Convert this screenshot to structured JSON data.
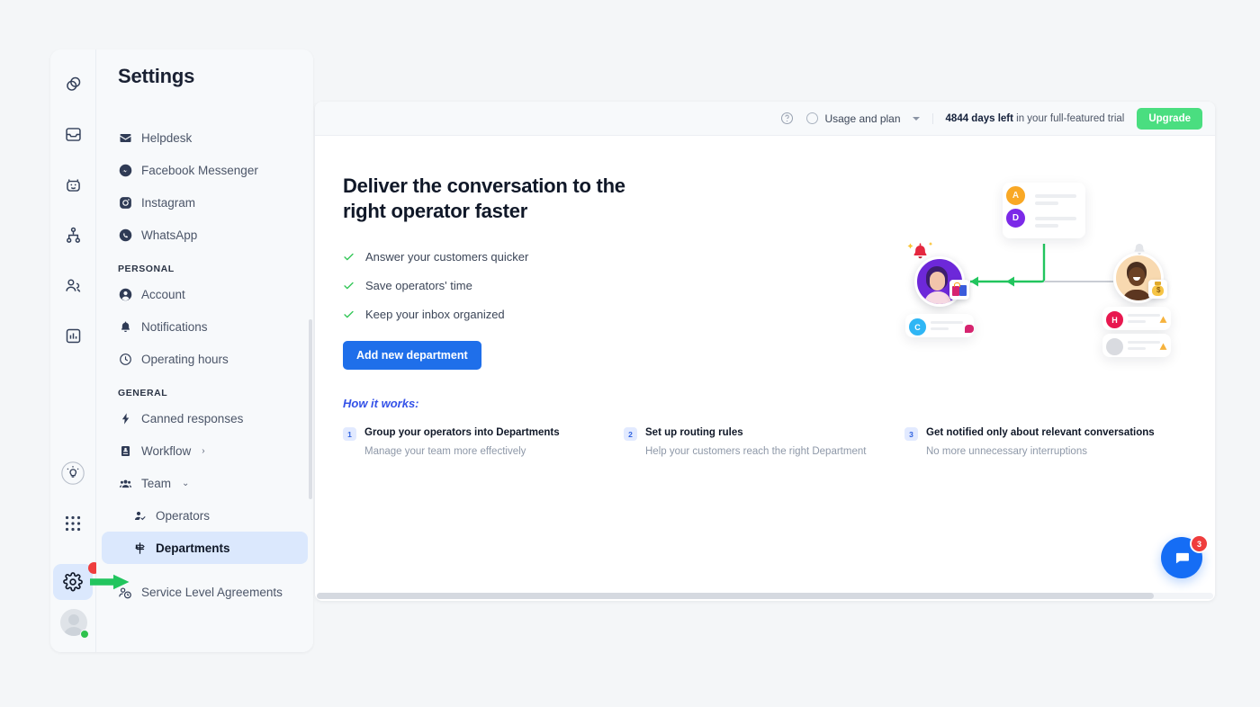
{
  "colors": {
    "accent_blue": "#1f6fea",
    "upgrade_green": "#4ade80",
    "selected_nav": "#dbe8fd",
    "arrow_green": "#22c55e",
    "badge_red": "#ef3d3d",
    "page_bg": "#f4f6f8"
  },
  "rail": {
    "items": [
      {
        "name": "logo-icon",
        "label": "Logo"
      },
      {
        "name": "inbox-icon",
        "label": "Inbox"
      },
      {
        "name": "chatbot-icon",
        "label": "Chatbot"
      },
      {
        "name": "flows-icon",
        "label": "Flows"
      },
      {
        "name": "contacts-icon",
        "label": "Contacts"
      },
      {
        "name": "reports-icon",
        "label": "Reports"
      }
    ],
    "bottom_items": [
      {
        "name": "tips-icon",
        "label": "Tips"
      },
      {
        "name": "apps-grid-icon",
        "label": "Apps"
      },
      {
        "name": "settings-gear-icon",
        "label": "Settings"
      }
    ]
  },
  "sidebar": {
    "title": "Settings",
    "channels": [
      {
        "label": "Helpdesk",
        "icon": "envelope-icon"
      },
      {
        "label": "Facebook Messenger",
        "icon": "messenger-icon"
      },
      {
        "label": "Instagram",
        "icon": "instagram-icon"
      },
      {
        "label": "WhatsApp",
        "icon": "whatsapp-icon"
      }
    ],
    "personal_header": "PERSONAL",
    "personal": [
      {
        "label": "Account",
        "icon": "user-circle-icon"
      },
      {
        "label": "Notifications",
        "icon": "bell-icon"
      },
      {
        "label": "Operating hours",
        "icon": "clock-icon"
      }
    ],
    "general_header": "GENERAL",
    "general": [
      {
        "label": "Canned responses",
        "icon": "bolt-icon",
        "chevron": ""
      },
      {
        "label": "Workflow",
        "icon": "workflow-icon",
        "chevron": "›"
      },
      {
        "label": "Team",
        "icon": "team-icon",
        "chevron": "⌄"
      }
    ],
    "team_children": [
      {
        "label": "Operators",
        "icon": "operator-icon",
        "selected": false
      },
      {
        "label": "Departments",
        "icon": "signpost-icon",
        "selected": true
      }
    ],
    "after_team": [
      {
        "label": "Service Level Agreements",
        "icon": "sla-icon"
      }
    ]
  },
  "topbar": {
    "help_icon": "help-circle-icon",
    "usage_label": "Usage and plan",
    "trial_days": "4844 days left",
    "trial_rest": " in your full-featured trial",
    "upgrade_label": "Upgrade"
  },
  "hero": {
    "title": "Deliver the conversation to the right operator faster",
    "benefits": [
      "Answer your customers quicker",
      "Save operators' time",
      "Keep your inbox organized"
    ],
    "cta_label": "Add new department"
  },
  "how_it_works": {
    "title": "How it works:",
    "steps": [
      {
        "num": "1",
        "head": "Group your operators into Departments",
        "sub": "Manage your team more effectively"
      },
      {
        "num": "2",
        "head": "Set up routing rules",
        "sub": "Help your customers reach the right Department"
      },
      {
        "num": "3",
        "head": "Get notified only about relevant conversations",
        "sub": "No more unnecessary interruptions"
      }
    ]
  },
  "illustration": {
    "avatar_letters": [
      {
        "letter": "A",
        "color": "#f9a825"
      },
      {
        "letter": "D",
        "color": "#7c2ae8"
      },
      {
        "letter": "C",
        "color": "#2fb6f5"
      },
      {
        "letter": "H",
        "color": "#e8184f"
      }
    ]
  },
  "chat_widget": {
    "badge_count": "3",
    "icon": "chat-bubble-icon"
  }
}
